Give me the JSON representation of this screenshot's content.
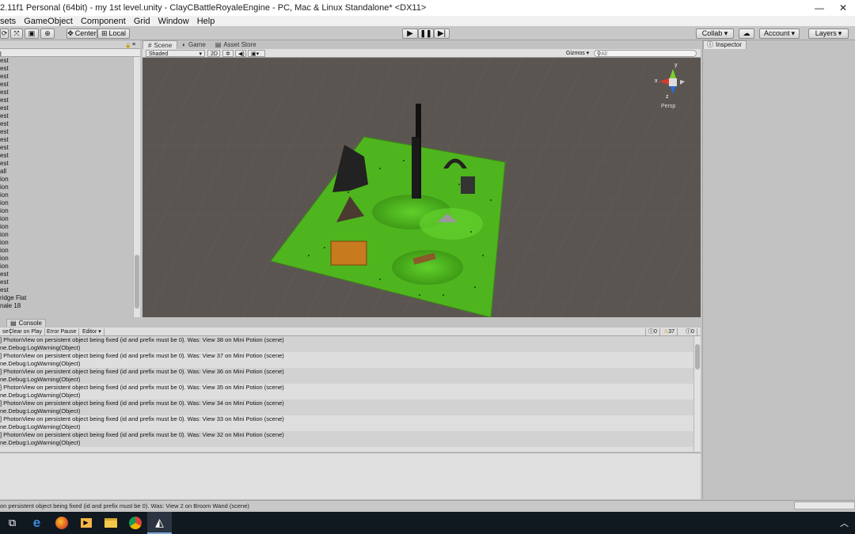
{
  "window": {
    "title": "2.11f1 Personal (64bit) - my 1st level.unity - ClayCBattleRoyaleEngine - PC, Mac & Linux Standalone* <DX11>",
    "minimize": "—",
    "close": "✕"
  },
  "menu": [
    "sets",
    "GameObject",
    "Component",
    "Grid",
    "Window",
    "Help"
  ],
  "toolbar": {
    "center_label": "Center",
    "local_label": "Local",
    "play_icon": "play-icon",
    "pause_icon": "pause-icon",
    "step_icon": "step-icon",
    "collab_label": "Collab ▾",
    "account_label": "Account",
    "layers_label": "Layers"
  },
  "hierarchy": {
    "items": [
      "est",
      "est",
      "est",
      "est",
      "est",
      "est",
      "est",
      "est",
      "est",
      "est",
      "est",
      "est",
      "est",
      "est",
      "all",
      "ion",
      "ion",
      "ion",
      "ion",
      "ion",
      "ion",
      "ion",
      "ion",
      "ion",
      "ion",
      "ion",
      "ion",
      "est",
      "est",
      "est",
      "ridge Flat",
      "nale 18"
    ],
    "search_value": "l"
  },
  "scene": {
    "tabs": [
      "Scene",
      "Game",
      "Asset Store"
    ],
    "shading_mode": "Shaded",
    "mode_2d": "2D",
    "gizmos_label": "Gizmos",
    "search_placeholder": "All",
    "persp_label": "Persp",
    "axis_x": "x",
    "axis_y": "y",
    "axis_z": "z"
  },
  "inspector": {
    "tab_label": "Inspector"
  },
  "console": {
    "tab_label": "Console",
    "clear_label": "se",
    "clear_on_play": "Clear on Play",
    "error_pause": "Error Pause",
    "editor_label": "Editor",
    "count_errors": "0",
    "count_warnings": "37",
    "count_logs": "0",
    "entries": [
      {
        "line1": "] PhotonView on persistent object being fixed (id and prefix must be 0). Was: View 38 on Mini Potion (scene)",
        "line2": "ne.Debug:LogWarning(Object)"
      },
      {
        "line1": "] PhotonView on persistent object being fixed (id and prefix must be 0). Was: View 37 on Mini Potion (scene)",
        "line2": "ne.Debug:LogWarning(Object)"
      },
      {
        "line1": "] PhotonView on persistent object being fixed (id and prefix must be 0). Was: View 36 on Mini Potion (scene)",
        "line2": "ne.Debug:LogWarning(Object)"
      },
      {
        "line1": "] PhotonView on persistent object being fixed (id and prefix must be 0). Was: View 35 on Mini Potion (scene)",
        "line2": "ne.Debug:LogWarning(Object)"
      },
      {
        "line1": "] PhotonView on persistent object being fixed (id and prefix must be 0). Was: View 34 on Mini Potion (scene)",
        "line2": "ne.Debug:LogWarning(Object)"
      },
      {
        "line1": "] PhotonView on persistent object being fixed (id and prefix must be 0). Was: View 33 on Mini Potion (scene)",
        "line2": "ne.Debug:LogWarning(Object)"
      },
      {
        "line1": "] PhotonView on persistent object being fixed (id and prefix must be 0). Was: View 32 on Mini Potion (scene)",
        "line2": "ne.Debug:LogWarning(Object)"
      }
    ]
  },
  "status_bar": {
    "message": " on persistent object being fixed (id and prefix must be 0). Was: View 2 on Broom Wand (scene)"
  },
  "taskbar": {
    "apps": [
      "task-view-icon",
      "edge-icon",
      "firefox-icon",
      "media-icon",
      "explorer-icon",
      "chrome-icon",
      "unity-icon"
    ]
  },
  "colors": {
    "terrain_green": "#4fb51e",
    "viewport_bg": "#5b5551",
    "taskbar": "#101820"
  }
}
